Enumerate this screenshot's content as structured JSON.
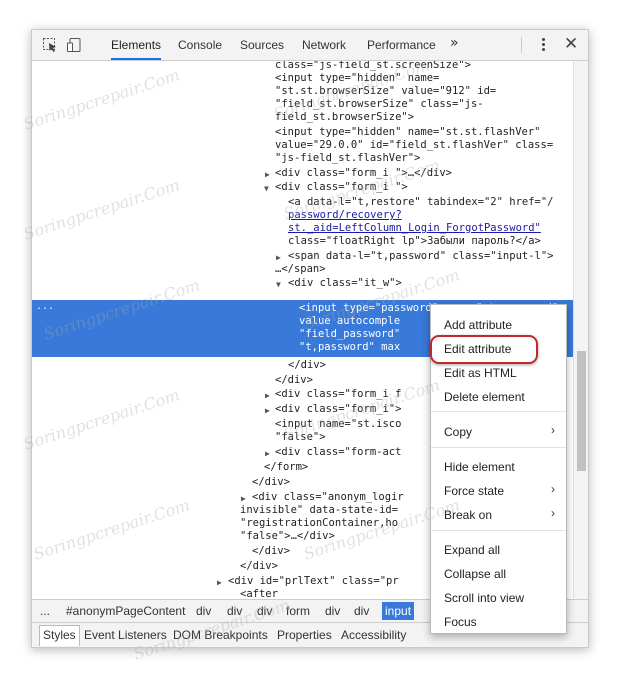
{
  "toolbar": {
    "tabs": [
      "Elements",
      "Console",
      "Sources",
      "Network",
      "Performance"
    ],
    "more": "»"
  },
  "tree_lines": [
    "class=\"js-field_st.screenSize\">",
    "<input type=\"hidden\" name=",
    "\"st.st.browserSize\" value=\"912\" id=",
    "\"field_st.browserSize\" class=\"js-",
    "field_st.browserSize\">",
    "<input type=\"hidden\" name=\"st.st.flashVer\"",
    "value=\"29.0.0\" id=\"field_st.flashVer\" class=",
    "\"js-field_st.flashVer\">",
    "<div class=\"form_i \">…</div>",
    "<div class=\"form_i \">",
    "<a data-l=\"t,restore\" tabindex=\"2\" href=\"/",
    "password/recovery?",
    "st._aid=LeftColumn_Login_ForgotPassword\"",
    "class=\"floatRight lp\">Забыли пароль?</a>",
    "<span data-l=\"t,password\" class=\"input-l\">",
    "…</span>",
    "<div class=\"it_w\">",
    "<input type=\"password\" name=\"st.password\"",
    "value autocomple",
    "\"field_password\"",
    "\"t,password\" max",
    "</div>",
    "</div>",
    "<div class=\"form_i f",
    "<div class=\"form_i\">",
    "<input name=\"st.isco",
    "\"false\">",
    "<div class=\"form-act",
    "</form>",
    "</div>",
    "<div class=\"anonym_logir",
    "invisible\" data-state-id=",
    "\"registrationContainer,ho",
    "\"false\">…</div>",
    "</div>",
    "</div>",
    "<div id=\"prlText\" class=\"pr",
    "<after"
  ],
  "selected_prefix": "...",
  "breadcrumbs": [
    "...",
    "#anonymPageContent",
    "div",
    "div",
    "div",
    "form",
    "div",
    "div",
    "input"
  ],
  "bottom_tabs": [
    "Styles",
    "Event Listeners",
    "DOM Breakpoints",
    "Properties",
    "Accessibility"
  ],
  "context_menu": {
    "items": [
      "Add attribute",
      "Edit attribute",
      "Edit as HTML",
      "Delete element",
      "Copy",
      "Hide element",
      "Force state",
      "Break on",
      "Expand all",
      "Collapse all",
      "Scroll into view",
      "Focus"
    ],
    "submenu_arrow": "›"
  },
  "watermark": "Soringpcrepair.Com",
  "colors": {
    "selection": "#3879d9",
    "highlight_ring": "#c0282d",
    "tag": "#881280",
    "attr_name": "#994500",
    "attr_value": "#1a1aa6"
  }
}
